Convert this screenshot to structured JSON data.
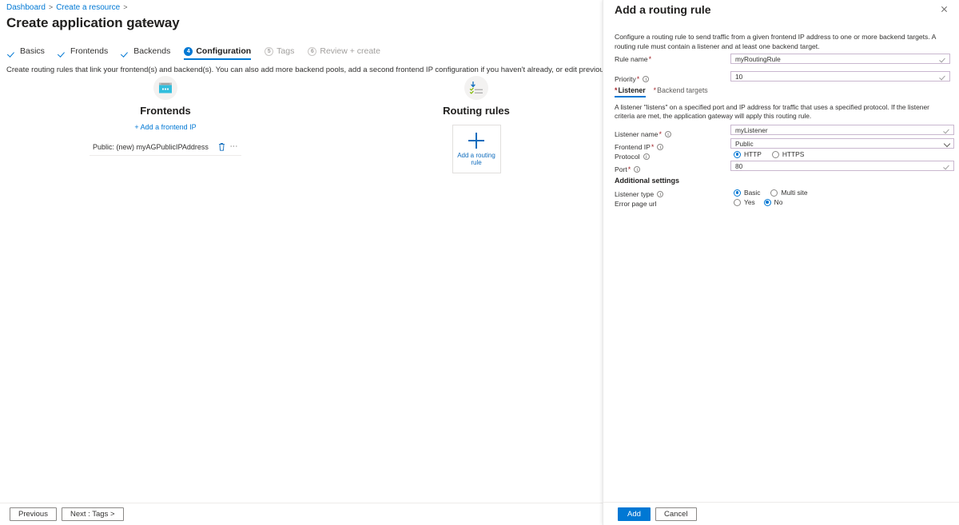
{
  "breadcrumb": {
    "items": [
      "Dashboard",
      "Create a resource"
    ],
    "separator": ">"
  },
  "page": {
    "title": "Create application gateway",
    "ellipsis": "⋯",
    "description": "Create routing rules that link your frontend(s) and backend(s). You can also add more backend pools, add a second frontend IP configuration if you haven't already, or edit previous configurations."
  },
  "wizard_tabs": [
    {
      "label": "Basics",
      "state": "done",
      "marker": "check"
    },
    {
      "label": "Frontends",
      "state": "done",
      "marker": "check"
    },
    {
      "label": "Backends",
      "state": "done",
      "marker": "check"
    },
    {
      "label": "Configuration",
      "state": "active",
      "marker": "4"
    },
    {
      "label": "Tags",
      "state": "pending",
      "marker": "5"
    },
    {
      "label": "Review + create",
      "state": "pending",
      "marker": "6"
    }
  ],
  "canvas": {
    "frontends": {
      "icon": "browser-window-icon",
      "heading": "Frontends",
      "add_link": "+ Add a frontend IP",
      "rows": [
        {
          "name": "Public: (new) myAGPublicIPAddress",
          "delete_icon": "trash-icon",
          "more_icon": "ellipsis-icon"
        }
      ]
    },
    "routing_rules": {
      "icon": "routing-rules-icon",
      "heading": "Routing rules",
      "card_label": "Add a routing\nrule",
      "card_label_line1": "Add a routing",
      "card_label_line2": "rule",
      "card_icon": "plus-icon"
    }
  },
  "footer": {
    "previous_label": "Previous",
    "next_label": "Next : Tags >"
  },
  "pane": {
    "title": "Add a routing rule",
    "close_icon": "close-icon",
    "description": "Configure a routing rule to send traffic from a given frontend IP address to one or more backend targets. A routing rule must contain a listener and at least one backend target.",
    "fields": {
      "rule_name": {
        "label": "Rule name",
        "required": true,
        "value": "myRoutingRule",
        "validation_icon": "checkmark-icon"
      },
      "priority": {
        "label": "Priority",
        "required": true,
        "info_icon": "info-icon",
        "value": "10",
        "validation_icon": "checkmark-icon"
      }
    },
    "subtabs": [
      {
        "label": "Listener",
        "required": true,
        "active": true
      },
      {
        "label": "Backend targets",
        "required": true,
        "active": false
      }
    ],
    "listener": {
      "description": "A listener \"listens\" on a specified port and IP address for traffic that uses a specified protocol. If the listener criteria are met, the application gateway will apply this routing rule.",
      "listener_name": {
        "label": "Listener name",
        "required": true,
        "info_icon": "info-icon",
        "value": "myListener",
        "validation_icon": "checkmark-icon"
      },
      "frontend_ip": {
        "label": "Frontend IP",
        "required": true,
        "info_icon": "info-icon",
        "value": "Public",
        "dropdown_icon": "chevron-down-icon"
      },
      "protocol": {
        "label": "Protocol",
        "required": false,
        "info_icon": "info-icon",
        "options": [
          {
            "label": "HTTP",
            "selected": true
          },
          {
            "label": "HTTPS",
            "selected": false
          }
        ]
      },
      "port": {
        "label": "Port",
        "required": true,
        "info_icon": "info-icon",
        "value": "80",
        "validation_icon": "checkmark-icon"
      }
    },
    "additional_settings": {
      "heading": "Additional settings",
      "listener_type": {
        "label": "Listener type",
        "info_icon": "info-icon",
        "options": [
          {
            "label": "Basic",
            "selected": true
          },
          {
            "label": "Multi site",
            "selected": false
          }
        ]
      },
      "error_page_url": {
        "label": "Error page url",
        "options": [
          {
            "label": "Yes",
            "selected": false
          },
          {
            "label": "No",
            "selected": true
          }
        ]
      }
    },
    "footer": {
      "add_label": "Add",
      "cancel_label": "Cancel"
    }
  },
  "colors": {
    "accent": "#0078d4",
    "link": "#0f6cbd",
    "required_star": "#a4262c",
    "input_border": "#c9b7cf",
    "icon_tile_bg": "#f3f2f1"
  }
}
